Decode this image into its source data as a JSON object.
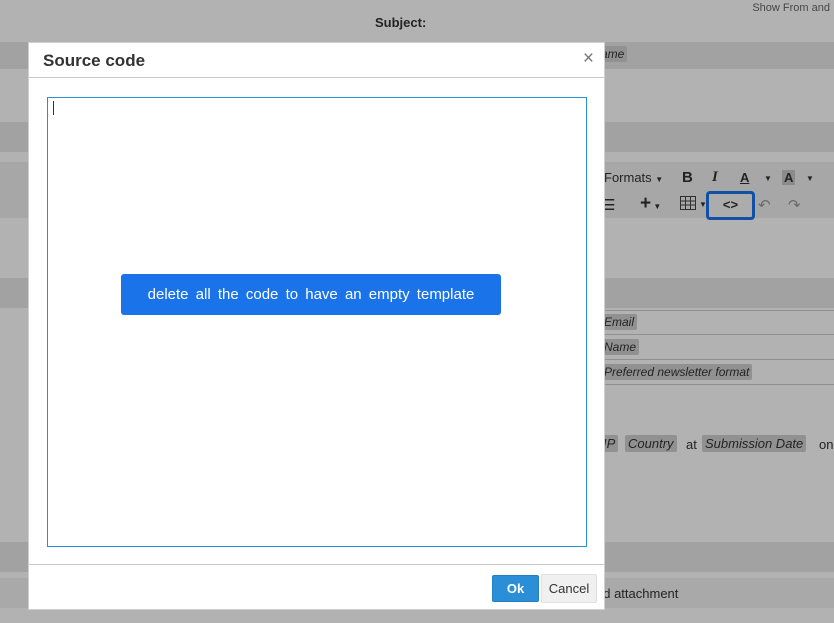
{
  "background": {
    "show_from": "Show From and",
    "subject_label": "Subject:",
    "name_tag": "ame",
    "toolbar": {
      "formats": "Formats",
      "bold": "B",
      "italic": "I",
      "font_color": "A",
      "bg_color": "A",
      "insert": "+",
      "code": "<>"
    },
    "tags": {
      "email": "Email",
      "name": "Name",
      "format": "Preferred newsletter format",
      "ip": "IP",
      "country": "Country",
      "submission_date": "Submission Date"
    },
    "text_at": "at",
    "text_on": "on",
    "add_attachment": "dd attachment"
  },
  "modal": {
    "title": "Source code",
    "close": "×",
    "code_value": "",
    "tooltip": "delete all the code to have an empty template",
    "ok_label": "Ok",
    "cancel_label": "Cancel"
  },
  "colors": {
    "accent": "#1a73e8",
    "primary_button": "#2a8fd6"
  }
}
